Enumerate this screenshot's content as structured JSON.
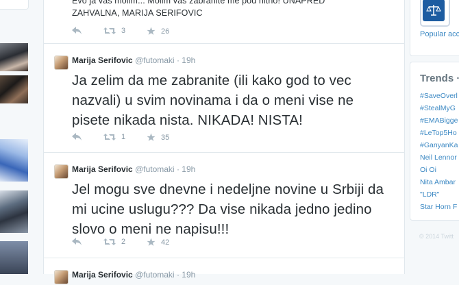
{
  "previous_tweet": {
    "text_line1": "Evo ja vas molim... Molim vas zabranite me pod hitno! UNAPRED",
    "text_line2": "ZAHVALNA, MARIJA SERIFOVIC",
    "retweets": "3",
    "favorites": "26"
  },
  "tweets": [
    {
      "name": "Marija Serifovic",
      "handle": "@futomaki",
      "time": "19h",
      "text": "Ja zelim da me zabranite (ili kako god to vec nazvali) u svim novinama i da o meni vise ne pisete nikada nista. NIKADA! NISTA!",
      "retweets": "1",
      "favorites": "35"
    },
    {
      "name": "Marija Serifovic",
      "handle": "@futomaki",
      "time": "19h",
      "text": "Jel mogu sve dnevne i nedeljne novine u Srbiji da mi ucine uslugu??? Da vise nikada jedno jedino slovo o meni ne napisu!!!",
      "retweets": "2",
      "favorites": "42"
    },
    {
      "name": "Marija Serifovic",
      "handle": "@futomaki",
      "time": "19h"
    }
  ],
  "sidebar": {
    "popular_accounts": "Popular acco",
    "trends_title": "Trends ·",
    "trends": [
      "#SaveOverl",
      "#StealMyG",
      "#EMABigge",
      "#LeTop5Ho",
      "#GanyanKa",
      "Neil Lennor",
      "Oi Oi",
      "Nita Ambar",
      "\"LDR\"",
      "Star Horn F"
    ],
    "footer": "© 2014 Twitt"
  },
  "colors": {
    "link": "#3b88c3",
    "text": "#292f33",
    "muted": "#8899a6",
    "border": "#e1e8ed"
  }
}
